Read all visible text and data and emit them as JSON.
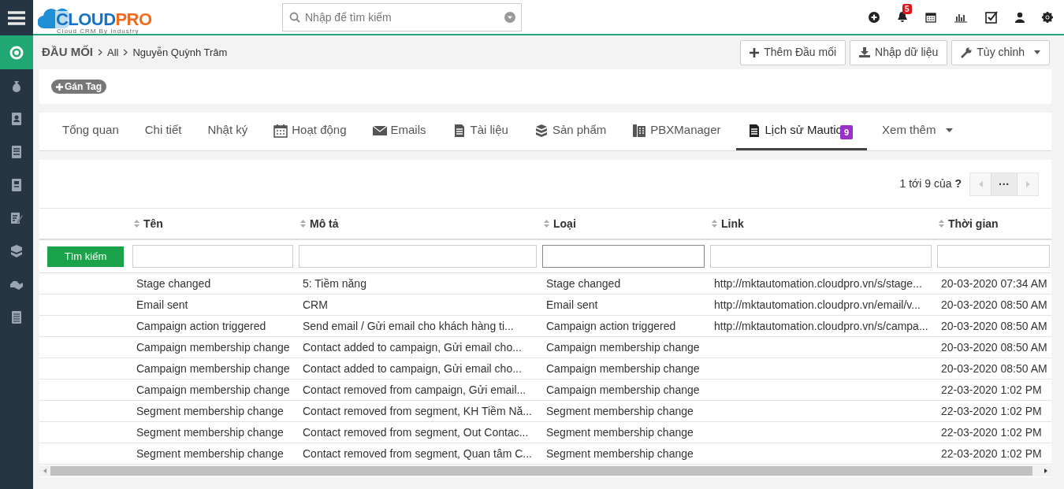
{
  "logo": {
    "text_primary": "CLOUD",
    "text_accent": "PRO",
    "tagline": "Cloud CRM By Industry"
  },
  "search": {
    "placeholder": "Nhập để tìm kiếm"
  },
  "notifications": {
    "badge": "5"
  },
  "sidebar": {
    "items": [
      {
        "selected": true
      },
      {
        "selected": false
      },
      {
        "selected": false
      },
      {
        "selected": false
      },
      {
        "selected": false
      },
      {
        "selected": false
      },
      {
        "selected": false
      },
      {
        "selected": false
      },
      {
        "selected": false
      }
    ]
  },
  "breadcrumb": [
    "ĐẦU MỐI",
    "All",
    "Nguyễn Quỳnh Trâm"
  ],
  "actions": [
    {
      "label": "Thêm Đầu mối",
      "kind": "plus"
    },
    {
      "label": "Nhập dữ liệu",
      "kind": "import"
    },
    {
      "label": "Tùy chỉnh",
      "kind": "wrench"
    }
  ],
  "tag_button": "Gán Tag",
  "tabs": [
    {
      "label": "Tổng quan",
      "selected": false
    },
    {
      "label": "Chi tiết",
      "selected": false
    },
    {
      "label": "Nhật ký",
      "selected": false
    },
    {
      "label": "Hoạt động",
      "selected": false
    },
    {
      "label": "Emails",
      "selected": false
    },
    {
      "label": "Tài liệu",
      "selected": false
    },
    {
      "label": "Sản phẩm",
      "selected": false
    },
    {
      "label": "PBXManager",
      "selected": false
    },
    {
      "label": "Lịch sử Mautic",
      "selected": true,
      "badge": "9"
    },
    {
      "label": "Xem thêm",
      "selected": false
    }
  ],
  "pager": {
    "text": "1 tới 9  của **?**",
    "more": "···"
  },
  "table": {
    "search_button": "Tìm kiếm",
    "columns": [
      "Tên",
      "Mô tả",
      "Loại",
      "Link",
      "Thời gian"
    ],
    "rows": [
      {
        "name": "Stage changed",
        "description": "5: Tiềm năng",
        "type": "Stage changed",
        "link": "http://mktautomation.cloudpro.vn/s/stage...",
        "time": "20-03-2020 07:34 AM"
      },
      {
        "name": "Email sent",
        "description": "CRM",
        "type": "Email sent",
        "link": "http://mktautomation.cloudpro.vn/email/v...",
        "time": "20-03-2020 08:50 AM"
      },
      {
        "name": "Campaign action triggered",
        "description": "Send email / Gửi email cho khách hàng ti...",
        "type": "Campaign action triggered",
        "link": "http://mktautomation.cloudpro.vn/s/campa...",
        "time": "20-03-2020 08:50 AM"
      },
      {
        "name": "Campaign membership change",
        "description": "Contact added to campaign, Gửi email cho...",
        "type": "Campaign membership change",
        "time": "20-03-2020 08:50 AM"
      },
      {
        "name": "Campaign membership change",
        "description": "Contact added to campaign, Gửi email cho...",
        "type": "Campaign membership change",
        "time": "20-03-2020 08:50 AM"
      },
      {
        "name": "Campaign membership change",
        "description": "Contact removed from campaign, Gửi email...",
        "type": "Campaign membership change",
        "time": "22-03-2020 1:02 PM"
      },
      {
        "name": "Segment membership change",
        "description": "Contact removed from segment, KH Tiềm Nă...",
        "type": "Segment membership change",
        "time": "22-03-2020 1:02 PM"
      },
      {
        "name": "Segment membership change",
        "description": "Contact removed from segment, Out Contac...",
        "type": "Segment membership change",
        "time": "22-03-2020 1:02 PM"
      },
      {
        "name": "Segment membership change",
        "description": "Contact removed from segment, Quan tâm C...",
        "type": "Segment membership change",
        "time": "22-03-2020 1:02 PM"
      }
    ]
  }
}
